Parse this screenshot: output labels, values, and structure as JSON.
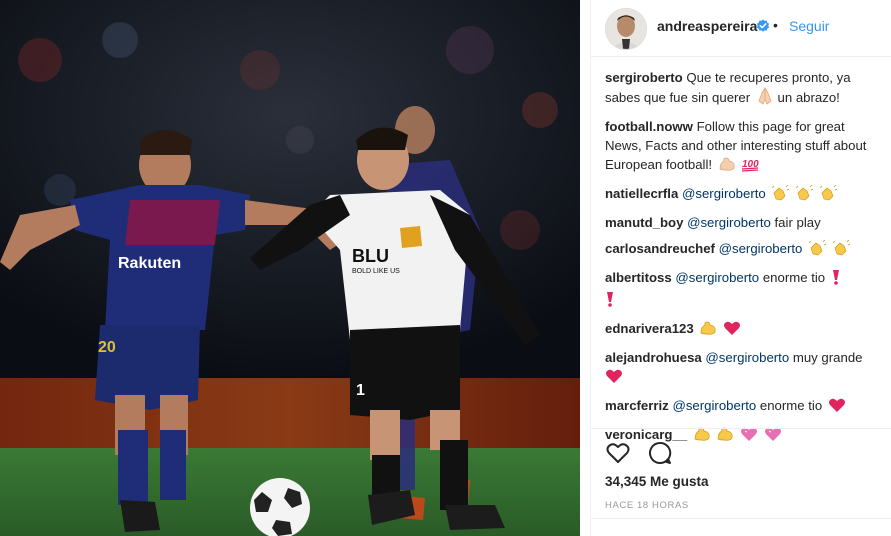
{
  "post": {
    "author": "andreaspereira",
    "follow_label": "Seguir",
    "likes_text": "34,345 Me gusta",
    "time_text": "HACE 18 HORAS"
  },
  "comments": [
    {
      "user": "sergiroberto",
      "text": "Que te recuperes pronto, ya sabes que fue sin querer",
      "after": "un abrazo!",
      "emojis": [
        "praying-hands"
      ]
    },
    {
      "user": "football.noww",
      "text": "Follow this page for great News, Facts and other interesting stuff about European football!",
      "emojis": [
        "flexed-biceps",
        "hundred-points"
      ]
    },
    {
      "user": "natiellecrfla",
      "mention": "@sergiroberto",
      "text": "",
      "emojis": [
        "clapping-hands",
        "clapping-hands",
        "clapping-hands"
      ]
    },
    {
      "user": "manutd_boy",
      "mention": "@sergiroberto",
      "text": "fair play",
      "emojis": []
    },
    {
      "user": "carlosandreuchef",
      "mention": "@sergiroberto",
      "text": "",
      "emojis": [
        "clapping-hands",
        "clapping-hands"
      ]
    },
    {
      "user": "albertitoss",
      "mention": "@sergiroberto",
      "text": "enorme tio",
      "emojis": [
        "exclamation-mark",
        "exclamation-mark"
      ]
    },
    {
      "user": "ednarivera123",
      "text": "",
      "emojis": [
        "flexed-biceps",
        "red-heart"
      ]
    },
    {
      "user": "alejandrohuesa",
      "mention": "@sergiroberto",
      "text": "muy grande",
      "emojis": [
        "red-heart"
      ]
    },
    {
      "user": "marcferriz",
      "mention": "@sergiroberto",
      "text": "enorme tio",
      "emojis": [
        "red-heart"
      ]
    },
    {
      "user": "veronicarg__",
      "text": "",
      "emojis": [
        "flexed-biceps",
        "flexed-biceps",
        "pink-heart",
        "pink-heart"
      ]
    }
  ],
  "photo": {
    "jersey_sponsor_left": "Rakuten",
    "jersey_sponsor_right": "BLU",
    "jersey_slogan_right": "BOLD LIKE US",
    "number_left": "20",
    "number_right": "1"
  },
  "colors": {
    "link": "#3897f0",
    "mention": "#003569",
    "verified": "#3897f0",
    "heart_red": "#e0245e",
    "barca_blue": "#1f2d78",
    "barca_red": "#a1113b"
  }
}
